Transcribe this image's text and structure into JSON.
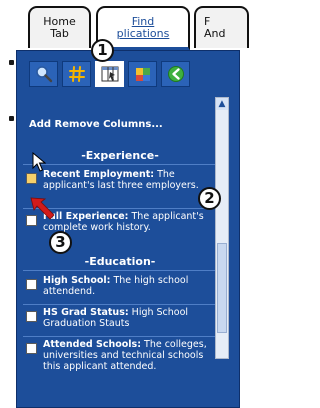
{
  "tabs": [
    {
      "line1": "Home",
      "line2": "Tab"
    },
    {
      "line1": "Find",
      "line2": "plications"
    },
    {
      "line1": "F",
      "line2": "And"
    }
  ],
  "toolbar": {
    "icons": [
      "search-icon",
      "hash-icon",
      "columns-icon",
      "puzzle-icon",
      "back-arrow-icon"
    ]
  },
  "panel": {
    "title": "Add Remove Columns..."
  },
  "sections": {
    "experience": "-Experience-",
    "education": "-Education-"
  },
  "items": {
    "recent_employment": {
      "name": "Recent Employment:",
      "desc": " The applicant's last three employers.",
      "checked": true
    },
    "full_experience": {
      "name": "Full Experience:",
      "desc": " The applicant's complete work history.",
      "checked": false
    },
    "high_school": {
      "name": "High School:",
      "desc": " The high school attendend.",
      "checked": false
    },
    "hs_grad_status": {
      "name": "HS Grad Status:",
      "desc": " High School Graduation Stauts",
      "checked": false
    },
    "attended_schools": {
      "name": "Attended Schools:",
      "desc": " The colleges, universities and technical schools this applicant attended.",
      "checked": false
    }
  },
  "callouts": {
    "one": "1",
    "two": "2",
    "three": "3"
  },
  "colors": {
    "panel": "#1d4e9a",
    "callout_bg": "#ffffff",
    "arrow": "#d11b1b",
    "checked": "#f7d06a"
  }
}
